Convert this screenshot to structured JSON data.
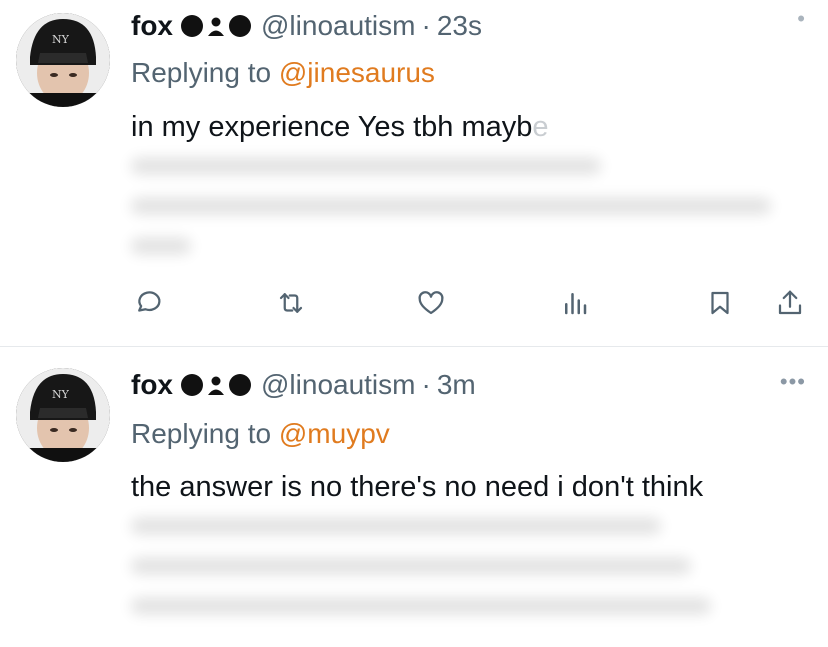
{
  "tweets": [
    {
      "name": "fox",
      "handle": "@linoautism",
      "separator": "·",
      "time": "23s",
      "replying_prefix": "Replying to ",
      "replying_to": "@jinesaurus",
      "text": "in my experience Yes tbh mayb",
      "text_faded": "e",
      "more_label": "•"
    },
    {
      "name": "fox",
      "handle": "@linoautism",
      "separator": "·",
      "time": "3m",
      "replying_prefix": "Replying to ",
      "replying_to": "@muypv",
      "text": "the answer is no there's no need i don't think",
      "more_label": "•••"
    }
  ],
  "icons": {
    "reply": "reply-icon",
    "retweet": "retweet-icon",
    "like": "heart-icon",
    "views": "views-icon",
    "bookmark": "bookmark-icon",
    "share": "share-icon"
  },
  "colors": {
    "mention": "#e07b1f",
    "secondary_text": "#536471",
    "icon": "#536471",
    "divider": "#e6e9ec"
  }
}
